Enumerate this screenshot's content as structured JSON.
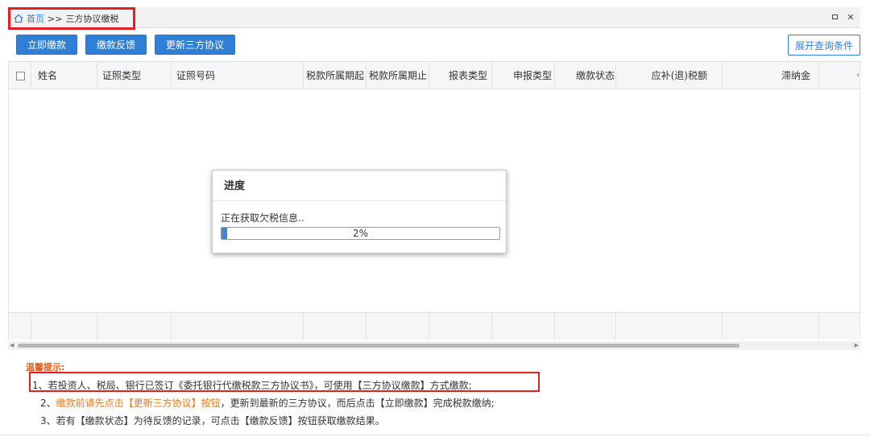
{
  "tab": {
    "home": "首页",
    "separator": ">>",
    "current": "三方协议缴税"
  },
  "toolbar": {
    "pay_now": "立即缴款",
    "feedback": "缴款反馈",
    "update_agreement": "更新三方协议",
    "expand_query": "展开查询条件"
  },
  "table": {
    "columns": [
      "姓名",
      "证照类型",
      "证照号码",
      "税款所属期起",
      "税款所属期止",
      "报表类型",
      "申报类型",
      "缴款状态",
      "应补(退)税额",
      "滞纳金"
    ]
  },
  "dialog": {
    "title": "进度",
    "message": "正在获取欠税信息..",
    "progress_text": "2%",
    "progress_value": 0.02
  },
  "tips": {
    "title": "温馨提示:",
    "line1": "1、若投资人、税局、银行已签订《委托银行代缴税款三方协议书》，可使用【三方协议缴款】方式缴款;",
    "line2_prefix": "2、",
    "line2_highlight": "缴款前请先点击【更新三方协议】按钮",
    "line2_rest": "，更新到最新的三方协议，而后点击【立即缴款】完成税款缴纳;",
    "line3": "3、若有【缴款状态】为待反馈的记录，可点击【缴款反馈】按钮获取缴款结果。"
  },
  "colors": {
    "primary": "#2f7fd6",
    "highlight_border": "#e02020",
    "tip_orange": "#ee7a14"
  }
}
